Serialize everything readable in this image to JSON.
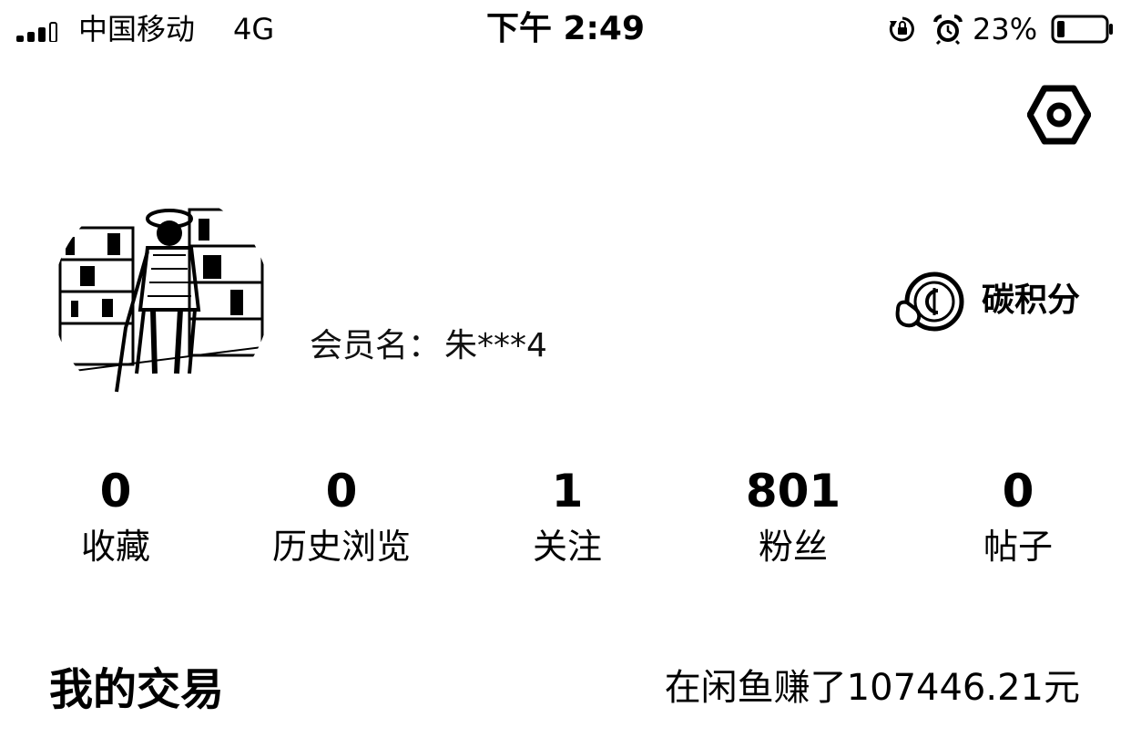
{
  "status_bar": {
    "carrier": "中国移动",
    "network": "4G",
    "time": "下午 2:49",
    "battery_percent": "23%",
    "battery_level": 0.23,
    "icons": [
      "signal-icon",
      "orientation-lock-icon",
      "alarm-icon",
      "battery-icon"
    ]
  },
  "header": {
    "settings_icon": "settings-hex-icon"
  },
  "profile": {
    "member_label": "会员名：",
    "member_name": "朱***4",
    "carbon_points_label": "碳积分",
    "carbon_icon": "carbon-coin-icon"
  },
  "stats": [
    {
      "value": "0",
      "label": "收藏"
    },
    {
      "value": "0",
      "label": "历史浏览"
    },
    {
      "value": "1",
      "label": "关注"
    },
    {
      "value": "801",
      "label": "粉丝"
    },
    {
      "value": "0",
      "label": "帖子"
    }
  ],
  "trade": {
    "title": "我的交易",
    "earned": "在闲鱼赚了107446.21元"
  },
  "colors": {
    "text": "#000000",
    "background": "#ffffff"
  }
}
